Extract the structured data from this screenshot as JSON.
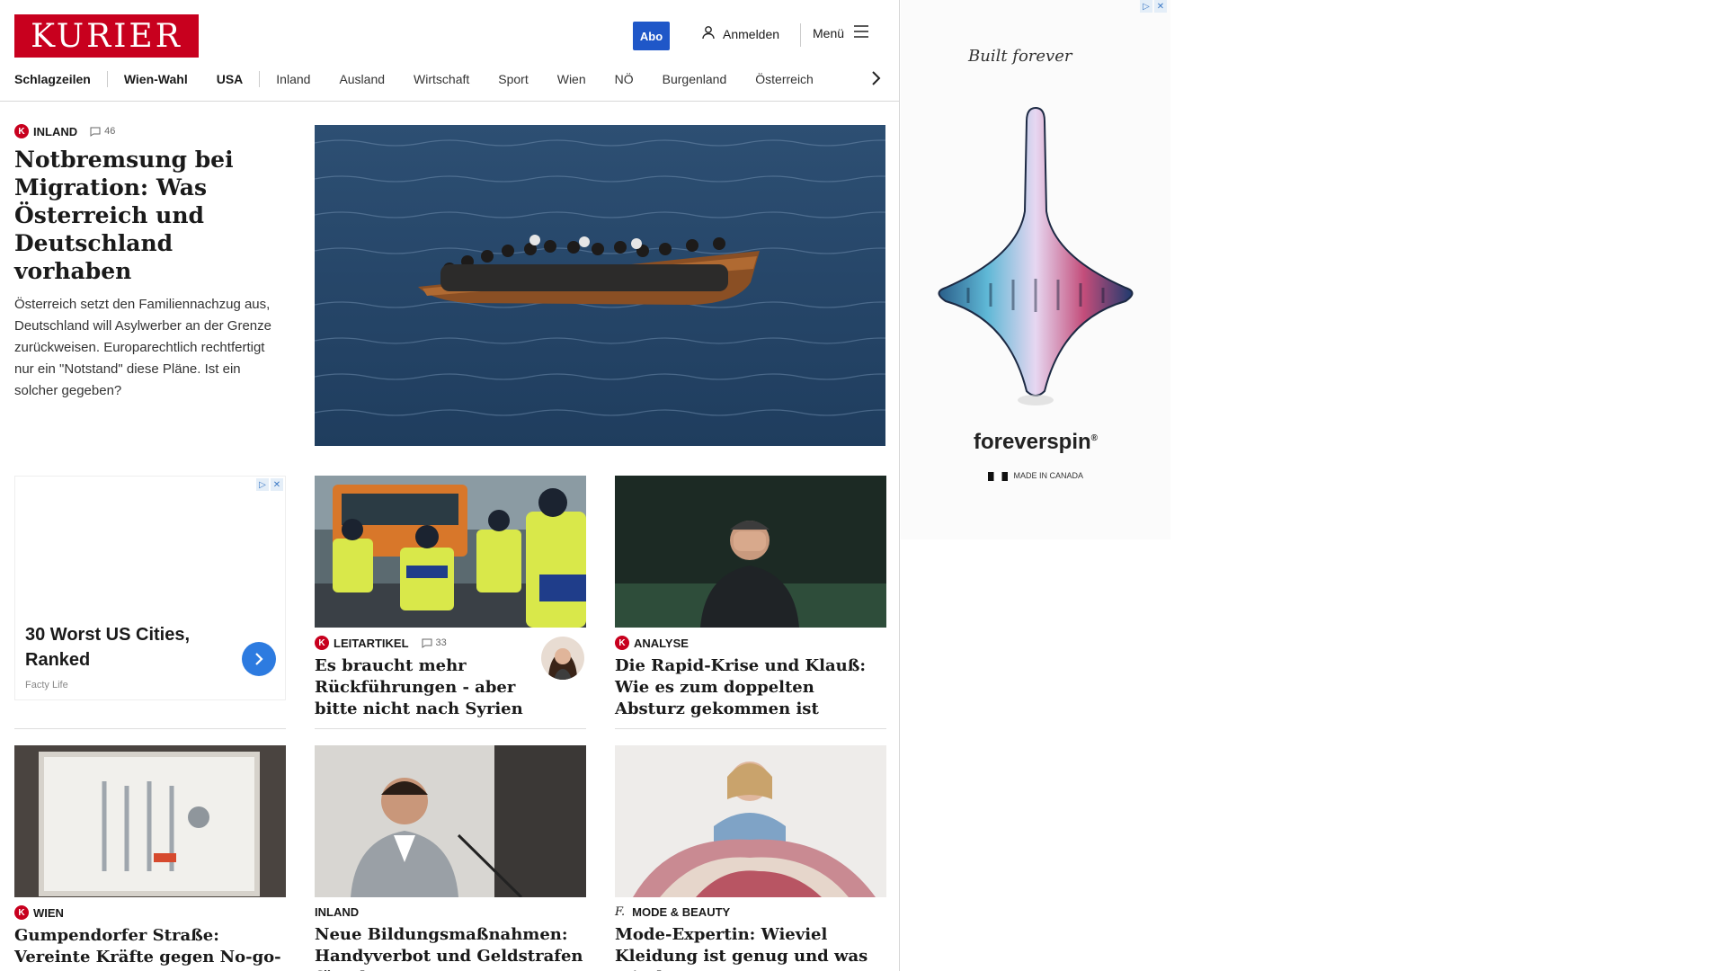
{
  "header": {
    "logo": "KURIER",
    "abo_label": "Abo",
    "login_label": "Anmelden",
    "menu_label": "Menü"
  },
  "nav": {
    "items": [
      "Schlagzeilen",
      "Wien-Wahl",
      "USA",
      "Inland",
      "Ausland",
      "Wirtschaft",
      "Sport",
      "Wien",
      "NÖ",
      "Burgenland",
      "Österreich"
    ]
  },
  "lead": {
    "category": "INLAND",
    "comments": "46",
    "title": "Notbremsung bei Migration: Was Österreich und Deutschland vorhaben",
    "text": "Österreich setzt den Familiennachzug aus, Deutschland will Asylwerber an der Grenze zurückweisen. Europarechtlich rechtfertigt nur ein \"Notstand\" diese Pläne. Ist ein solcher gegeben?"
  },
  "ad_small": {
    "title": "30 Worst US Cities, Ranked",
    "source": "Facty Life"
  },
  "cards": [
    {
      "category": "LEITARTIKEL",
      "comments": "33",
      "title": "Es braucht mehr Rückführungen - aber bitte nicht nach Syrien"
    },
    {
      "category": "ANALYSE",
      "title": "Die Rapid-Krise und Klauß: Wie es zum doppelten Absturz gekommen ist"
    },
    {
      "category": "WIEN",
      "title": "Gumpendorfer Straße: Vereinte Kräfte gegen No-go-Zonen"
    },
    {
      "category": "INLAND",
      "title": "Neue Bildungsmaßnahmen: Handyverbot und Geldstrafen für Eltern?"
    },
    {
      "category": "MODE & BEAUTY",
      "title": "Mode-Expertin: Wieviel Kleidung ist genug und was mit dem Rest?"
    }
  ],
  "side_ad": {
    "tagline": "Built forever",
    "brand": "foreverspin",
    "made_in": "MADE IN CANADA"
  },
  "colors": {
    "brand_red": "#c8001e",
    "abo_blue": "#1f57c8"
  }
}
